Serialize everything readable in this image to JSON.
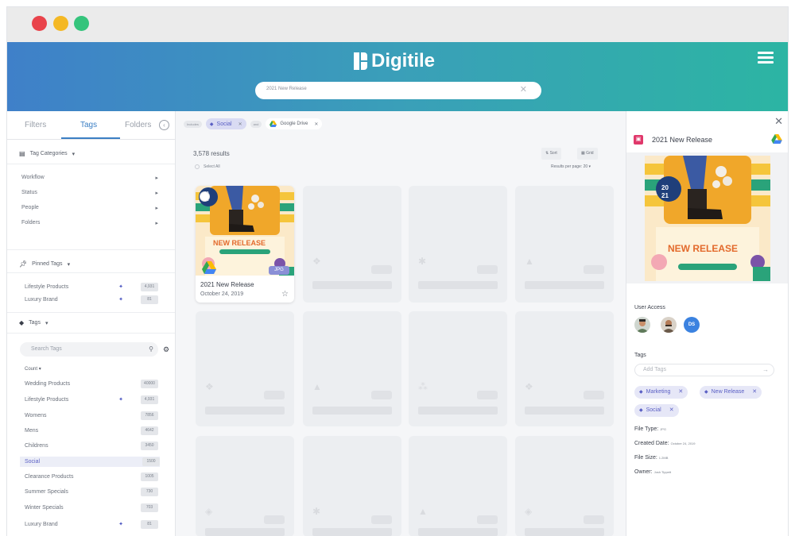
{
  "app": {
    "logo_text": "Digitile",
    "search_value": "2021 New Release"
  },
  "sidebar": {
    "tabs": [
      "Filters",
      "Tags",
      "Folders"
    ],
    "tag_categories_label": "Tag Categories",
    "categories": [
      "Workflow",
      "Status",
      "People",
      "Folders"
    ],
    "pinned_label": "Pinned Tags",
    "pinned": [
      {
        "label": "Lifestyle Products",
        "count": "4,931"
      },
      {
        "label": "Luxury Brand",
        "count": "81"
      }
    ],
    "tags_label": "Tags",
    "search_placeholder": "Search Tags",
    "sort_label": "Count",
    "tags": [
      {
        "label": "Wedding Products",
        "count": "40000",
        "pinned": false
      },
      {
        "label": "Lifestyle Products",
        "count": "4,931",
        "pinned": true
      },
      {
        "label": "Womens",
        "count": "7856",
        "pinned": false
      },
      {
        "label": "Mens",
        "count": "4642",
        "pinned": false
      },
      {
        "label": "Childrens",
        "count": "3450",
        "pinned": false
      },
      {
        "label": "Social",
        "count": "1500",
        "pinned": false,
        "selected": true
      },
      {
        "label": "Clearance Products",
        "count": "1005",
        "pinned": false
      },
      {
        "label": "Summer Specials",
        "count": "730",
        "pinned": false
      },
      {
        "label": "Winter Specials",
        "count": "703",
        "pinned": false
      },
      {
        "label": "Luxury Brand",
        "count": "81",
        "pinned": true
      }
    ]
  },
  "main": {
    "filter_prefix": "Includes",
    "filter_tag": "Social",
    "filter_join": "and",
    "filter_source": "Google Drive",
    "results_count": "3,578 results",
    "select_all": "Select All",
    "sort_label": "Sort",
    "grid_label": "Grid",
    "per_page": "Results per page: 20 ▾",
    "asset": {
      "title": "2021 New Release",
      "date": "October 24, 2019",
      "type_badge": "JPG"
    },
    "placeholder_icons": [
      "dropbox",
      "slack",
      "drive",
      "dropbox",
      "drive",
      "box",
      "dropbox",
      "sheet",
      "slack",
      "drive",
      "sheet"
    ]
  },
  "panel": {
    "title": "2021 New Release",
    "user_access_label": "User Access",
    "avatars": [
      "",
      "",
      "DS"
    ],
    "tags_label": "Tags",
    "add_tags_placeholder": "Add Tags",
    "tags": [
      "Marketing",
      "New Release",
      "Social"
    ],
    "file_type_label": "File Type:",
    "file_type_value": "JPG",
    "created_label": "Created Date:",
    "created_value": "October 24, 2019",
    "size_label": "File Size:",
    "size_value": "1.2MB",
    "owner_label": "Owner:",
    "owner_value": "Josh Tippett"
  },
  "thumb": {
    "year_top": "20",
    "year_bottom": "21",
    "headline": "NEW RELEASE"
  },
  "colors": {
    "accent": "#3b7fc4",
    "tag": "#5a5fc4",
    "header_start": "#3f80c9",
    "header_end": "#2cb5a3"
  }
}
